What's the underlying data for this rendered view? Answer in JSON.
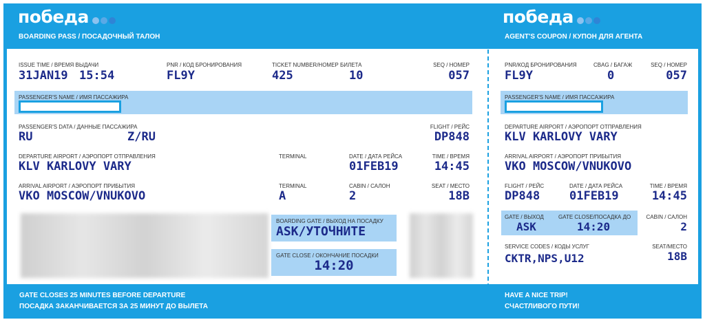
{
  "brand": {
    "logo_text": "победа",
    "dot_colors": [
      "#8cc2ef",
      "#5aa9e6",
      "#2f84d6"
    ]
  },
  "boarding_pass": {
    "subtitle": "BOARDING PASS / ПОСАДОЧНЫЙ ТАЛОН",
    "issue_time_label": "ISSUE TIME / ВРЕМЯ ВЫДАЧИ",
    "issue_date": "31JAN19",
    "issue_time": "15:54",
    "pnr_label": "PNR / КОД БРОНИРОВАНИЯ",
    "pnr": "FL9Y",
    "ticket_label": "TICKET NUMBER/НОМЕР БИЛЕТА",
    "ticket_a": "425",
    "ticket_b": "10",
    "seq_label": "SEQ / НОМЕР",
    "seq": "057",
    "passenger_name_label": "PASSENGER'S NAME / ИМЯ ПАССАЖИРА",
    "passenger_data_label": "PASSENGER'S DATA / ДАННЫЕ ПАССАЖИРА",
    "passenger_data_a": "RU",
    "passenger_data_b": "Z/RU",
    "flight_label": "FLIGHT / РЕЙС",
    "flight": "DP848",
    "departure_label": "DEPARTURE AIRPORT / АЭРОПОРТ ОТПРАВЛЕНИЯ",
    "departure": "KLV KARLOVY VARY",
    "terminal_label": "TERMINAL",
    "date_label": "DATE / ДАТА РЕЙСА",
    "date": "01FEB19",
    "time_label": "TIME / ВРЕМЯ",
    "time": "14:45",
    "arrival_label": "ARRIVAL AIRPORT / АЭРОПОРТ ПРИБЫТИЯ",
    "arrival": "VKO MOSCOW/VNUKOVO",
    "terminal2_label": "TERMINAL",
    "terminal2": "A",
    "cabin_label": "CABIN / САЛОН",
    "cabin": "2",
    "seat_label": "SEAT / МЕСТО",
    "seat": "18B",
    "gate_label": "BOARDING GATE / ВЫХОД НА ПОСАДКУ",
    "gate": "ASK/УТОЧНИТЕ",
    "gate_close_label": "GATE CLOSE / ОКОНЧАНИЕ ПОСАДКИ",
    "gate_close": "14:20",
    "footer_line1": "GATE CLOSES 25 MINUTES BEFORE DEPARTURE",
    "footer_line2": "ПОСАДКА ЗАКАНЧИВАЕТСЯ ЗА 25 МИНУТ ДО ВЫЛЕТА"
  },
  "coupon": {
    "subtitle": "AGENT'S COUPON / КУПОН ДЛЯ АГЕНТА",
    "pnr_label": "PNR/КОД БРОНИРОВАНИЯ",
    "pnr": "FL9Y",
    "bag_label": "CBAG / БАГАЖ",
    "bag": "0",
    "seq_label": "SEQ / НОМЕР",
    "seq": "057",
    "passenger_name_label": "PASSENGER'S NAME / ИМЯ ПАССАЖИРА",
    "departure_label": "DEPARTURE AIRPORT / АЭРОПОРТ ОТПРАВЛЕНИЯ",
    "departure": "KLV KARLOVY VARY",
    "arrival_label": "ARRIVAL AIRPORT / АЭРОПОРТ ПРИБЫТИЯ",
    "arrival": "VKO MOSCOW/VNUKOVO",
    "flight_label": "FLIGHT / РЕЙС",
    "flight": "DP848",
    "date_label": "DATE / ДАТА РЕЙСА",
    "date": "01FEB19",
    "time_label": "TIME / ВРЕМЯ",
    "time": "14:45",
    "gate_label": "GATE / ВЫХОД",
    "gate": "ASK",
    "gate_close_label": "GATE CLOSE/ПОСАДКА ДО",
    "gate_close": "14:20",
    "cabin_label": "CABIN / САЛОН",
    "cabin": "2",
    "service_label": "SERVICE CODES / КОДЫ УСЛУГ",
    "service": "CKTR,NPS,U12",
    "seat_label": "SEAT/МЕСТО",
    "seat": "18B",
    "footer_line1": "HAVE A NICE TRIP!",
    "footer_line2": "СЧАСТЛИВОГО ПУТИ!"
  }
}
